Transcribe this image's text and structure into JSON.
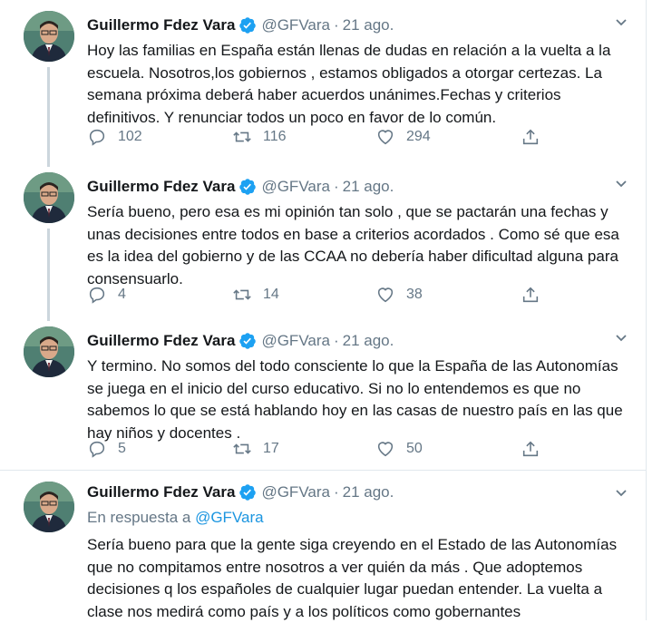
{
  "tweets": [
    {
      "name": "Guillermo Fdez Vara",
      "handle": "@GFVara",
      "dot": "·",
      "date": "21 ago.",
      "reply_prefix": "",
      "reply_handle": "",
      "text": "Hoy las familias en España están llenas de dudas en relación a la vuelta a la escuela. Nosotros,los gobiernos , estamos obligados a otorgar certezas. La semana próxima deberá haber acuerdos unánimes.Fechas y criterios definitivos. Y renunciar todos un poco en favor de lo común.",
      "replies": "102",
      "retweets": "116",
      "likes": "294"
    },
    {
      "name": "Guillermo Fdez Vara",
      "handle": "@GFVara",
      "dot": "·",
      "date": "21 ago.",
      "text": "Sería bueno, pero esa es mi opinión tan solo , que se pactarán una fechas y unas decisiones entre todos en base a criterios acordados  . Como sé que esa es la idea del gobierno y de las CCAA no debería haber dificultad alguna para consensuarlo.",
      "replies": "4",
      "retweets": "14",
      "likes": "38"
    },
    {
      "name": "Guillermo Fdez Vara",
      "handle": "@GFVara",
      "dot": "·",
      "date": "21 ago.",
      "text": "Y termino. No somos del todo consciente lo que la España de las Autonomías se juega en el inicio del curso educativo. Si no lo entendemos es que no sabemos lo que se está hablando hoy en las casas de nuestro país en las que hay niños y docentes .",
      "replies": "5",
      "retweets": "17",
      "likes": "50"
    },
    {
      "name": "Guillermo Fdez Vara",
      "handle": "@GFVara",
      "dot": "·",
      "date": "21 ago.",
      "reply_prefix": "En respuesta a ",
      "reply_handle": "@GFVara",
      "text": "Sería bueno para que la gente siga creyendo en el Estado de las Autonomías que no compitamos entre nosotros a ver quién da más . Que adoptemos decisiones q los españoles de cualquier lugar puedan entender. La vuelta a clase nos medirá como país y a los políticos como gobernantes"
    }
  ],
  "icons": {
    "verified": "verified-badge-icon",
    "caret": "chevron-down-icon",
    "reply": "reply-icon",
    "retweet": "retweet-icon",
    "like": "heart-icon",
    "share": "share-icon"
  },
  "colors": {
    "accent": "#1da1f2",
    "link": "#1b95e0",
    "muted": "#657786",
    "text": "#14171a",
    "thread_line": "#ccd6dd"
  }
}
